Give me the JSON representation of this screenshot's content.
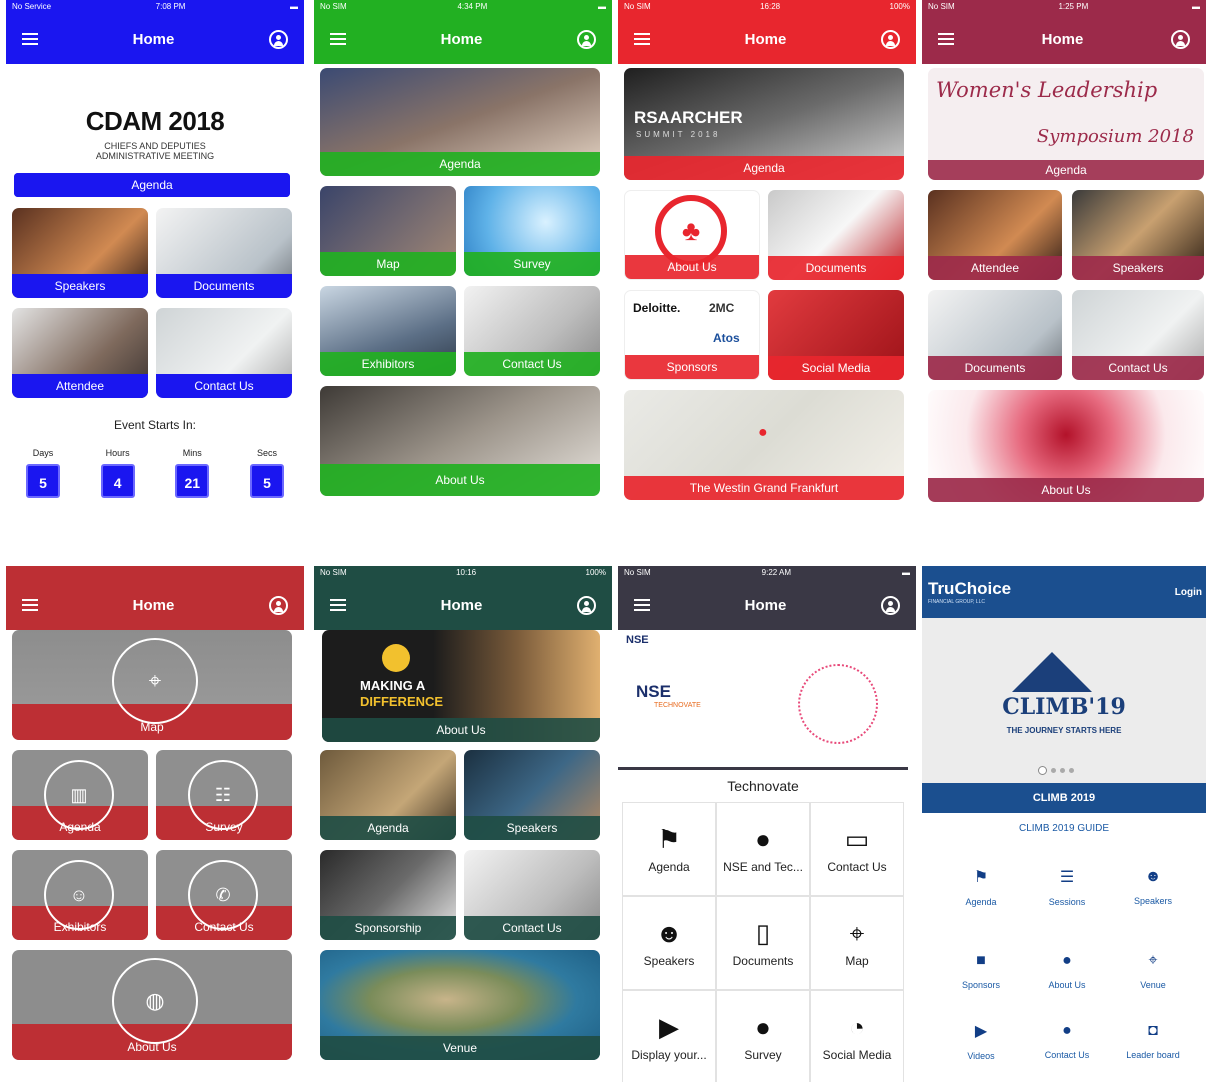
{
  "p1": {
    "status": {
      "left": "No Service",
      "time": "7:08 PM"
    },
    "title": "Home",
    "logo_title": "CDAM 2018",
    "logo_sub1": "CHIEFS AND DEPUTIES",
    "logo_sub2": "ADMINISTRATIVE MEETING",
    "tiles": [
      "Agenda",
      "Speakers",
      "Documents",
      "Attendee",
      "Contact Us"
    ],
    "countdown_title": "Event Starts In:",
    "units": [
      "Days",
      "Hours",
      "Mins",
      "Secs"
    ],
    "values": [
      "5",
      "4",
      "21",
      "5"
    ],
    "accent": "#1a16f0"
  },
  "p2": {
    "status": {
      "left": "No SIM",
      "time": "4:34 PM"
    },
    "title": "Home",
    "tiles": [
      "Agenda",
      "Map",
      "Survey",
      "Exhibitors",
      "Contact Us",
      "About Us"
    ],
    "accent": "#22b022"
  },
  "p3": {
    "status": {
      "left": "No SIM",
      "time": "16:28",
      "right": "100%"
    },
    "title": "Home",
    "banner_text": "RSAARCHER",
    "banner_sub": "SUMMIT 2018",
    "tiles": [
      "Agenda",
      "About Us",
      "Documents",
      "Sponsors",
      "Social Media",
      "The Westin Grand Frankfurt"
    ],
    "sponsor_logos": [
      "Deloitte.",
      "2MC",
      "Atos"
    ],
    "accent": "#e8262e"
  },
  "p4": {
    "status": {
      "left": "No SIM",
      "time": "1:25 PM"
    },
    "title": "Home",
    "banner_line1": "Women's Leadership",
    "banner_line2": "Symposium 2018",
    "tiles": [
      "Agenda",
      "Attendee",
      "Speakers",
      "Documents",
      "Contact Us",
      "About Us"
    ],
    "accent": "#9c2a4a"
  },
  "p5": {
    "title": "Home",
    "tiles": [
      "Map",
      "Agenda",
      "Survey",
      "Exhibitors",
      "Contact Us",
      "About Us"
    ],
    "accent": "#bd2f34"
  },
  "p6": {
    "status": {
      "left": "No SIM",
      "time": "10:16",
      "right": "100%"
    },
    "title": "Home",
    "banner_text1": "MAKING A",
    "banner_text2": "DIFFERENCE",
    "tiles": [
      "About Us",
      "Agenda",
      "Speakers",
      "Sponsorship",
      "Contact Us",
      "Venue"
    ],
    "accent": "#1f4d44"
  },
  "p7": {
    "status": {
      "left": "No SIM",
      "time": "9:22 AM"
    },
    "title": "Home",
    "brand": "NSE",
    "brand_sub": "TECHNOVATE",
    "section_title": "Technovate",
    "cells": [
      "Agenda",
      "NSE and Tec...",
      "Contact Us",
      "Speakers",
      "Documents",
      "Map",
      "Display your...",
      "Survey",
      "Social Media"
    ],
    "accent": "#3a3845"
  },
  "p8": {
    "brand": "TruChoice",
    "brand_sub": "FINANCIAL GROUP, LLC",
    "login": "Login",
    "hero_title": "CLIMB",
    "hero_year": "'19",
    "hero_tag": "THE JOURNEY STARTS HERE",
    "section_bar": "CLIMB 2019",
    "guide": "CLIMB 2019 GUIDE",
    "cells": [
      "Agenda",
      "Sessions",
      "Speakers",
      "Sponsors",
      "About Us",
      "Venue",
      "Videos",
      "Contact Us",
      "Leader board"
    ],
    "accent": "#1b4f8f"
  }
}
